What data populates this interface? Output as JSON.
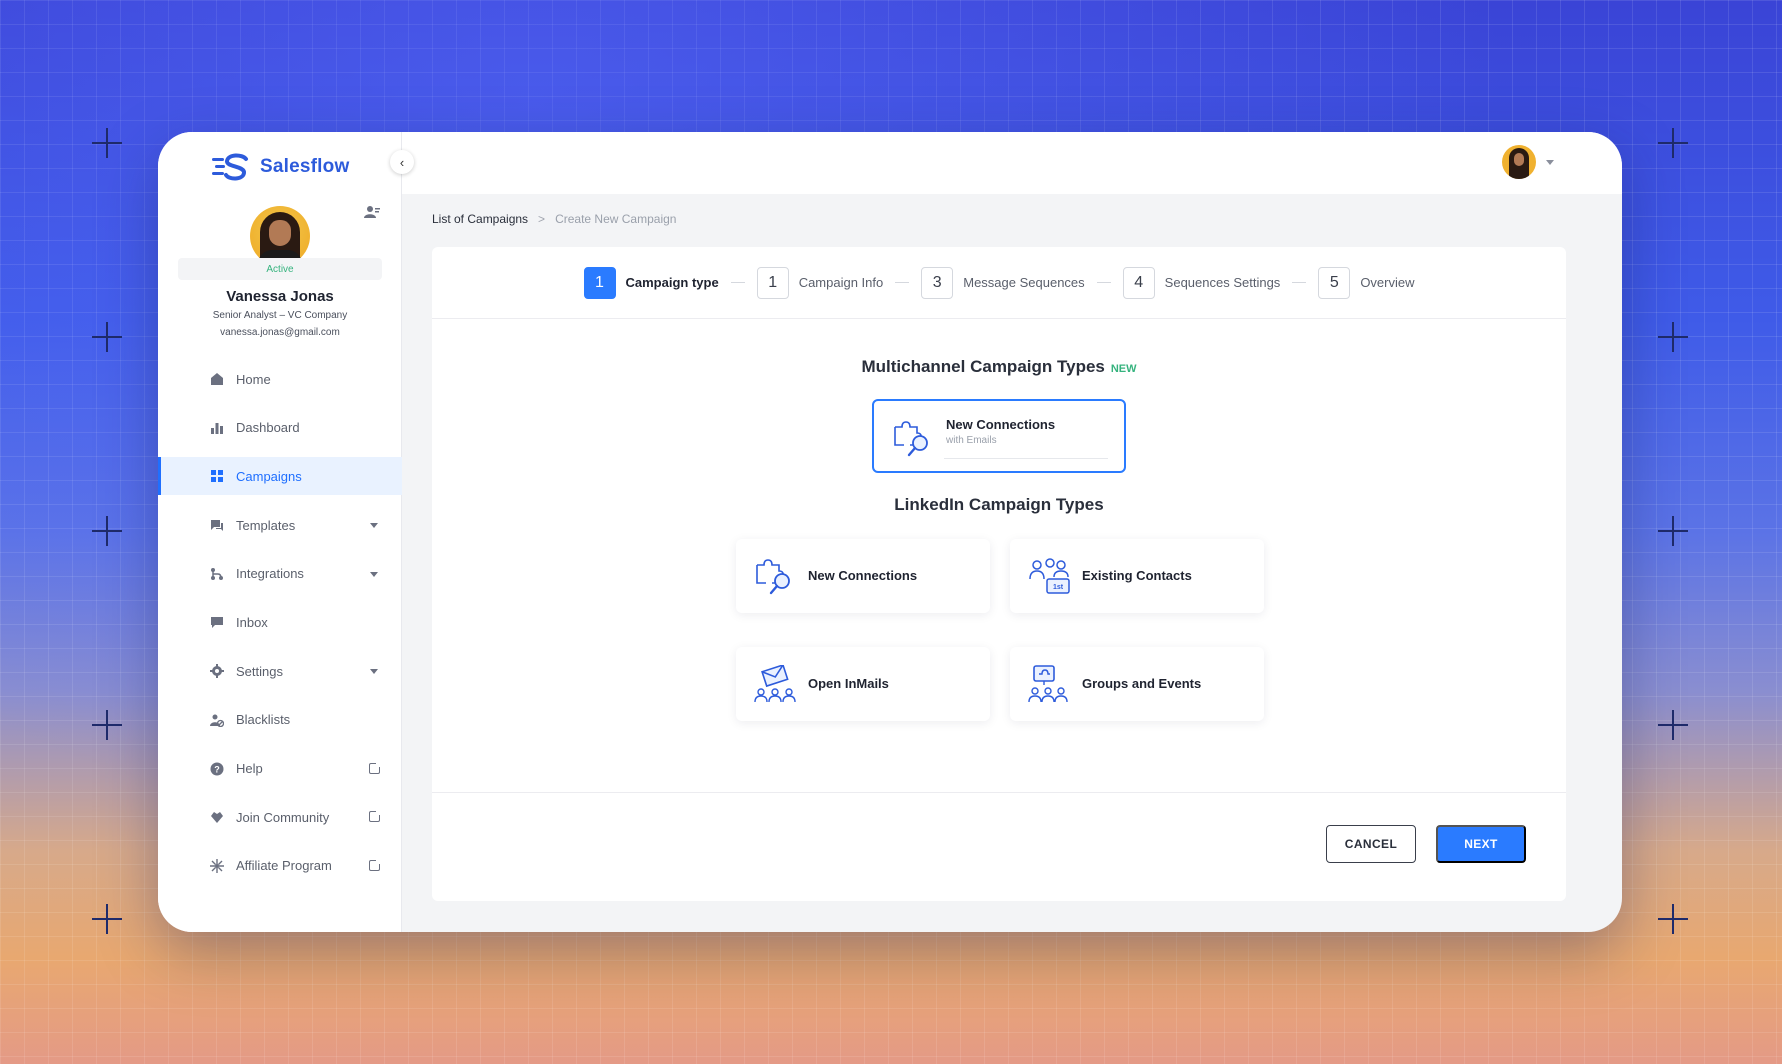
{
  "app": {
    "logo_text": "Salesflow"
  },
  "profile": {
    "status": "Active",
    "name": "Vanessa Jonas",
    "role": "Senior Analyst – VC Company",
    "email": "vanessa.jonas@gmail.com"
  },
  "sidebar": {
    "items": [
      {
        "label": "Home",
        "icon": "home-icon"
      },
      {
        "label": "Dashboard",
        "icon": "bar-chart-icon"
      },
      {
        "label": "Campaigns",
        "icon": "grid-icon",
        "active": true
      },
      {
        "label": "Templates",
        "icon": "chat-icon",
        "expandable": true
      },
      {
        "label": "Integrations",
        "icon": "integrations-icon",
        "expandable": true
      },
      {
        "label": "Inbox",
        "icon": "inbox-icon"
      },
      {
        "label": "Settings",
        "icon": "gear-icon",
        "expandable": true
      },
      {
        "label": "Blacklists",
        "icon": "blacklist-icon"
      },
      {
        "label": "Help",
        "icon": "help-icon",
        "external": true
      },
      {
        "label": "Join Community",
        "icon": "community-icon",
        "external": true
      },
      {
        "label": "Affiliate Program",
        "icon": "affiliate-icon",
        "external": true
      }
    ]
  },
  "breadcrumb": {
    "parent": "List of Campaigns",
    "separator": ">",
    "current": "Create New Campaign"
  },
  "stepper": {
    "steps": [
      {
        "num": "1",
        "label": "Campaign type",
        "active": true
      },
      {
        "num": "1",
        "label": "Campaign Info"
      },
      {
        "num": "3",
        "label": "Message Sequences"
      },
      {
        "num": "4",
        "label": "Sequences Settings"
      },
      {
        "num": "5",
        "label": "Overview"
      }
    ]
  },
  "multichannel": {
    "title": "Multichannel Campaign Types",
    "badge": "NEW",
    "card": {
      "title": "New Connections",
      "subtitle": "with Emails"
    }
  },
  "linkedin": {
    "title": "LinkedIn Campaign Types",
    "cards": [
      {
        "title": "New Connections"
      },
      {
        "title": "Existing Contacts"
      },
      {
        "title": "Open InMails"
      },
      {
        "title": "Groups and Events"
      }
    ]
  },
  "actions": {
    "cancel": "CANCEL",
    "next": "NEXT"
  },
  "colors": {
    "accent": "#2a7bff",
    "success": "#36b37e",
    "active_bg": "#e9f2ff"
  }
}
